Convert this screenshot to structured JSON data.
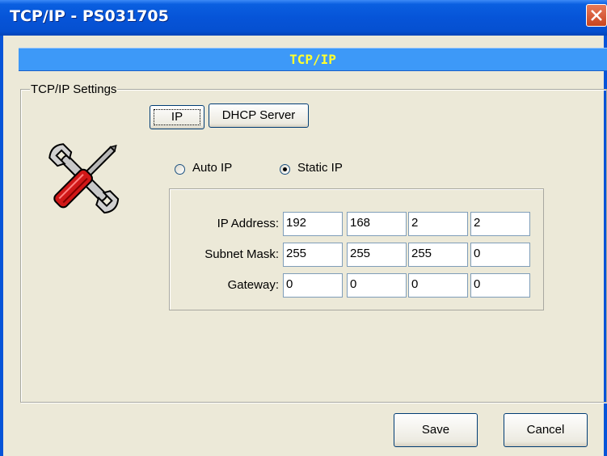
{
  "window": {
    "title": "TCP/IP - PS031705",
    "close_icon": "close-icon"
  },
  "banner": {
    "text": "TCP/IP"
  },
  "group": {
    "legend": "TCP/IP Settings"
  },
  "tabs": [
    {
      "label": "IP",
      "selected": true
    },
    {
      "label": "DHCP Server",
      "selected": false
    }
  ],
  "icon": {
    "name": "wrench-screwdriver-icon"
  },
  "mode": {
    "options": [
      {
        "label": "Auto IP",
        "checked": false
      },
      {
        "label": "Static IP",
        "checked": true
      }
    ]
  },
  "fields": [
    {
      "label": "IP Address:",
      "octets": [
        "192",
        "168",
        "2",
        "2"
      ]
    },
    {
      "label": "Subnet Mask:",
      "octets": [
        "255",
        "255",
        "255",
        "0"
      ]
    },
    {
      "label": "Gateway:",
      "octets": [
        "0",
        "0",
        "0",
        "0"
      ]
    }
  ],
  "buttons": {
    "save": "Save",
    "cancel": "Cancel"
  },
  "colors": {
    "title_bar": "#0654d8",
    "banner_bg": "#3d99f8",
    "banner_text": "#ffff30",
    "dialog_bg": "#ece9d8"
  }
}
